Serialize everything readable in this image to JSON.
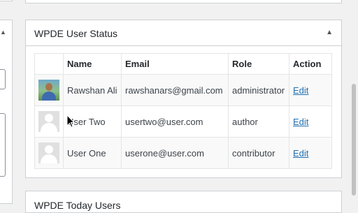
{
  "widget": {
    "title": "WPDE User Status",
    "toggle_icon": "triangle-up-icon"
  },
  "table": {
    "headers": [
      "",
      "Name",
      "Email",
      "Role",
      "Action"
    ],
    "rows": [
      {
        "avatar": "user-photo",
        "name": "Rawshan Ali",
        "email": "rawshanars@gmail.com",
        "role": "administrator",
        "action": "Edit"
      },
      {
        "avatar": "default-avatar",
        "name": "User Two",
        "email": "usertwo@user.com",
        "role": "author",
        "action": "Edit"
      },
      {
        "avatar": "default-avatar",
        "name": "User One",
        "email": "userone@user.com",
        "role": "contributor",
        "action": "Edit"
      }
    ]
  },
  "bottom_widget": {
    "title": "WPDE Today Users"
  },
  "colors": {
    "link": "#2271b1",
    "border": "#ccd0d4",
    "background": "#f1f1f1"
  }
}
